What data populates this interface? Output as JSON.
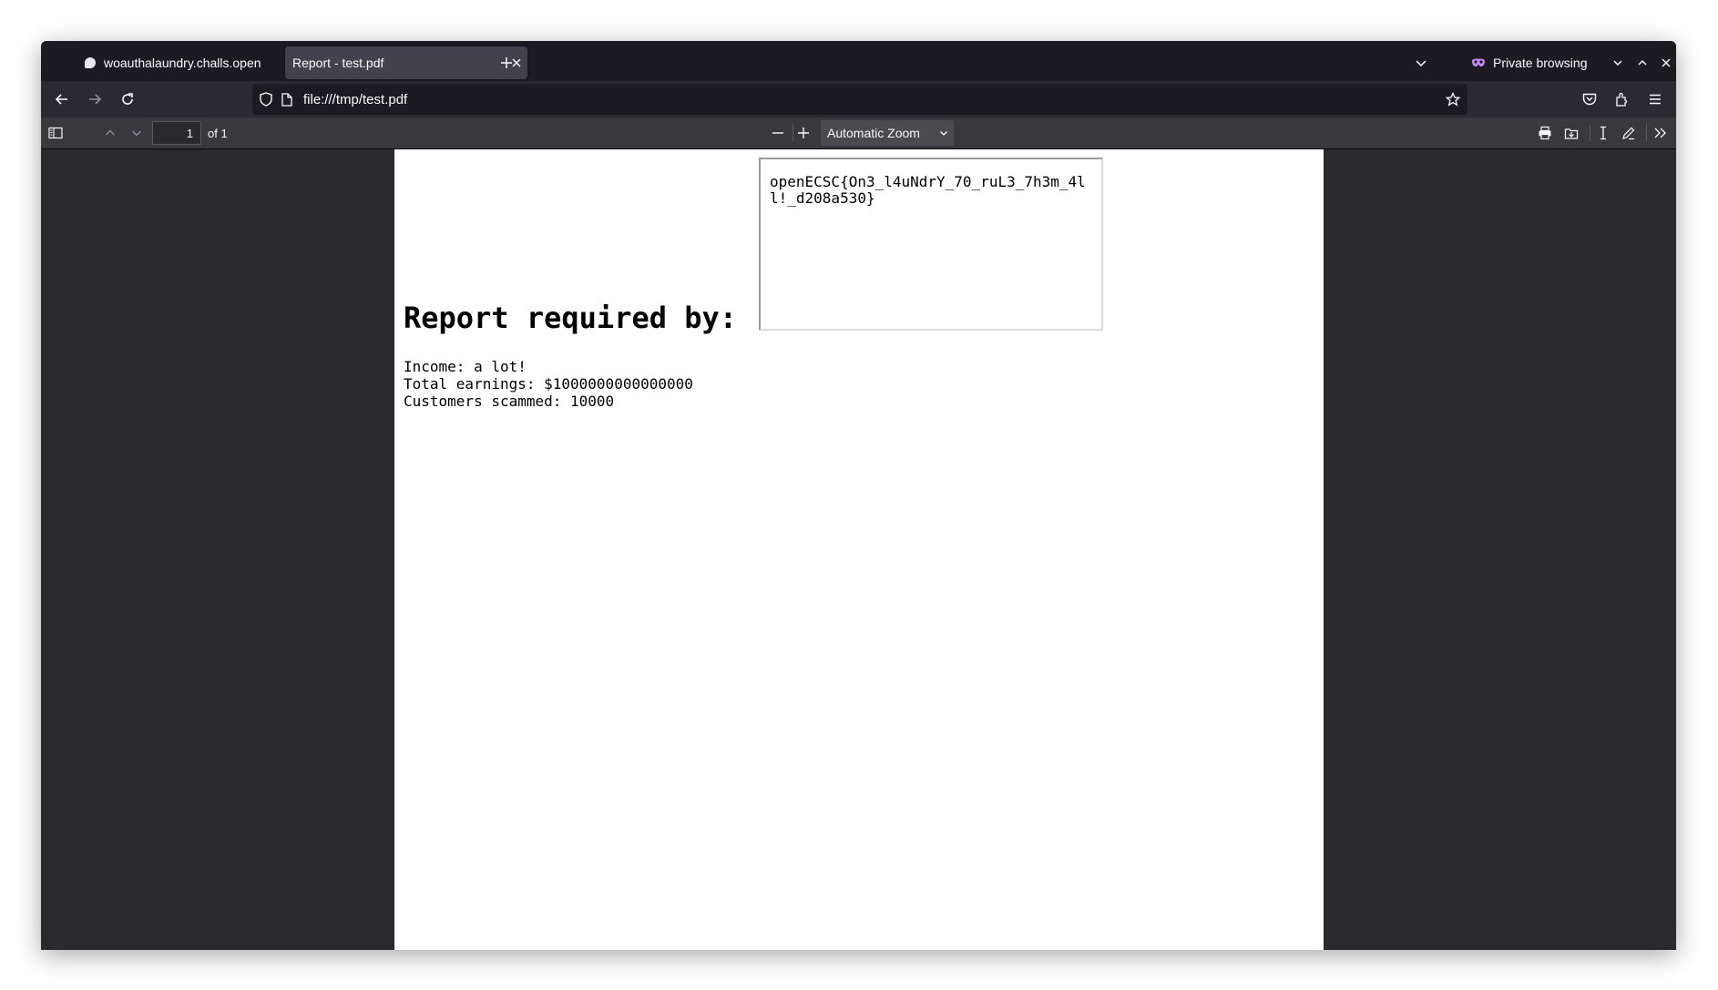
{
  "tabs": [
    {
      "title": "woauthalaundry.challs.open",
      "active": false
    },
    {
      "title": "Report - test.pdf",
      "active": true
    }
  ],
  "private_label": "Private browsing",
  "url": "file:///tmp/test.pdf",
  "pdf_toolbar": {
    "page_number": "1",
    "page_count": "of 1",
    "zoom": "Automatic Zoom"
  },
  "document": {
    "flag_box": "openECSC{On3_l4uNdrY_70_ruL3_7h3m_4ll!_d208a530}",
    "heading": "Report required by:",
    "lines": [
      "Income: a lot!",
      "Total earnings: $1000000000000000",
      "Customers scammed: 10000"
    ]
  },
  "colors": {
    "tabstrip": "#1c1b22",
    "toolbar": "#2b2a33",
    "pdf_toolbar": "#38383d",
    "viewer_bg": "#2a2a2e",
    "private_accent": "#8000d7"
  },
  "icons": [
    "favicon-icon",
    "close-icon",
    "plus-icon",
    "chevron-down-icon",
    "private-mask-icon",
    "minimize-icon",
    "maximize-icon",
    "back-icon",
    "forward-icon",
    "reload-icon",
    "shield-icon",
    "page-icon",
    "star-icon",
    "pocket-icon",
    "extensions-icon",
    "menu-icon",
    "sidebar-toggle-icon",
    "chevron-up-icon",
    "zoom-out-icon",
    "zoom-in-icon",
    "print-icon",
    "save-icon",
    "text-cursor-icon",
    "pen-icon",
    "double-chevron-icon"
  ]
}
